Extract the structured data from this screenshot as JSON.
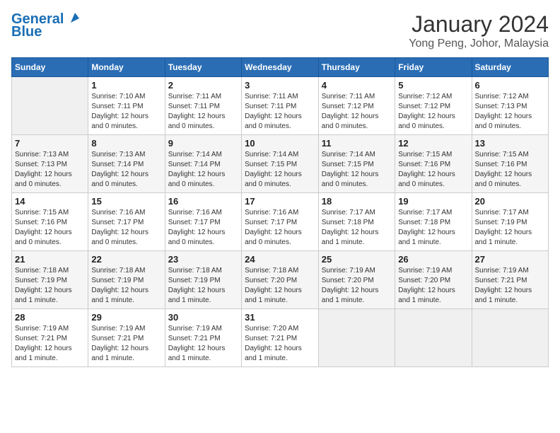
{
  "logo": {
    "line1": "General",
    "line2": "Blue"
  },
  "header": {
    "title": "January 2024",
    "subtitle": "Yong Peng, Johor, Malaysia"
  },
  "weekdays": [
    "Sunday",
    "Monday",
    "Tuesday",
    "Wednesday",
    "Thursday",
    "Friday",
    "Saturday"
  ],
  "weeks": [
    [
      {
        "day": "",
        "sunrise": "",
        "sunset": "",
        "daylight": ""
      },
      {
        "day": "1",
        "sunrise": "Sunrise: 7:10 AM",
        "sunset": "Sunset: 7:11 PM",
        "daylight": "Daylight: 12 hours and 0 minutes."
      },
      {
        "day": "2",
        "sunrise": "Sunrise: 7:11 AM",
        "sunset": "Sunset: 7:11 PM",
        "daylight": "Daylight: 12 hours and 0 minutes."
      },
      {
        "day": "3",
        "sunrise": "Sunrise: 7:11 AM",
        "sunset": "Sunset: 7:11 PM",
        "daylight": "Daylight: 12 hours and 0 minutes."
      },
      {
        "day": "4",
        "sunrise": "Sunrise: 7:11 AM",
        "sunset": "Sunset: 7:12 PM",
        "daylight": "Daylight: 12 hours and 0 minutes."
      },
      {
        "day": "5",
        "sunrise": "Sunrise: 7:12 AM",
        "sunset": "Sunset: 7:12 PM",
        "daylight": "Daylight: 12 hours and 0 minutes."
      },
      {
        "day": "6",
        "sunrise": "Sunrise: 7:12 AM",
        "sunset": "Sunset: 7:13 PM",
        "daylight": "Daylight: 12 hours and 0 minutes."
      }
    ],
    [
      {
        "day": "7",
        "sunrise": "Sunrise: 7:13 AM",
        "sunset": "Sunset: 7:13 PM",
        "daylight": "Daylight: 12 hours and 0 minutes."
      },
      {
        "day": "8",
        "sunrise": "Sunrise: 7:13 AM",
        "sunset": "Sunset: 7:14 PM",
        "daylight": "Daylight: 12 hours and 0 minutes."
      },
      {
        "day": "9",
        "sunrise": "Sunrise: 7:14 AM",
        "sunset": "Sunset: 7:14 PM",
        "daylight": "Daylight: 12 hours and 0 minutes."
      },
      {
        "day": "10",
        "sunrise": "Sunrise: 7:14 AM",
        "sunset": "Sunset: 7:15 PM",
        "daylight": "Daylight: 12 hours and 0 minutes."
      },
      {
        "day": "11",
        "sunrise": "Sunrise: 7:14 AM",
        "sunset": "Sunset: 7:15 PM",
        "daylight": "Daylight: 12 hours and 0 minutes."
      },
      {
        "day": "12",
        "sunrise": "Sunrise: 7:15 AM",
        "sunset": "Sunset: 7:16 PM",
        "daylight": "Daylight: 12 hours and 0 minutes."
      },
      {
        "day": "13",
        "sunrise": "Sunrise: 7:15 AM",
        "sunset": "Sunset: 7:16 PM",
        "daylight": "Daylight: 12 hours and 0 minutes."
      }
    ],
    [
      {
        "day": "14",
        "sunrise": "Sunrise: 7:15 AM",
        "sunset": "Sunset: 7:16 PM",
        "daylight": "Daylight: 12 hours and 0 minutes."
      },
      {
        "day": "15",
        "sunrise": "Sunrise: 7:16 AM",
        "sunset": "Sunset: 7:17 PM",
        "daylight": "Daylight: 12 hours and 0 minutes."
      },
      {
        "day": "16",
        "sunrise": "Sunrise: 7:16 AM",
        "sunset": "Sunset: 7:17 PM",
        "daylight": "Daylight: 12 hours and 0 minutes."
      },
      {
        "day": "17",
        "sunrise": "Sunrise: 7:16 AM",
        "sunset": "Sunset: 7:17 PM",
        "daylight": "Daylight: 12 hours and 0 minutes."
      },
      {
        "day": "18",
        "sunrise": "Sunrise: 7:17 AM",
        "sunset": "Sunset: 7:18 PM",
        "daylight": "Daylight: 12 hours and 1 minute."
      },
      {
        "day": "19",
        "sunrise": "Sunrise: 7:17 AM",
        "sunset": "Sunset: 7:18 PM",
        "daylight": "Daylight: 12 hours and 1 minute."
      },
      {
        "day": "20",
        "sunrise": "Sunrise: 7:17 AM",
        "sunset": "Sunset: 7:19 PM",
        "daylight": "Daylight: 12 hours and 1 minute."
      }
    ],
    [
      {
        "day": "21",
        "sunrise": "Sunrise: 7:18 AM",
        "sunset": "Sunset: 7:19 PM",
        "daylight": "Daylight: 12 hours and 1 minute."
      },
      {
        "day": "22",
        "sunrise": "Sunrise: 7:18 AM",
        "sunset": "Sunset: 7:19 PM",
        "daylight": "Daylight: 12 hours and 1 minute."
      },
      {
        "day": "23",
        "sunrise": "Sunrise: 7:18 AM",
        "sunset": "Sunset: 7:19 PM",
        "daylight": "Daylight: 12 hours and 1 minute."
      },
      {
        "day": "24",
        "sunrise": "Sunrise: 7:18 AM",
        "sunset": "Sunset: 7:20 PM",
        "daylight": "Daylight: 12 hours and 1 minute."
      },
      {
        "day": "25",
        "sunrise": "Sunrise: 7:19 AM",
        "sunset": "Sunset: 7:20 PM",
        "daylight": "Daylight: 12 hours and 1 minute."
      },
      {
        "day": "26",
        "sunrise": "Sunrise: 7:19 AM",
        "sunset": "Sunset: 7:20 PM",
        "daylight": "Daylight: 12 hours and 1 minute."
      },
      {
        "day": "27",
        "sunrise": "Sunrise: 7:19 AM",
        "sunset": "Sunset: 7:21 PM",
        "daylight": "Daylight: 12 hours and 1 minute."
      }
    ],
    [
      {
        "day": "28",
        "sunrise": "Sunrise: 7:19 AM",
        "sunset": "Sunset: 7:21 PM",
        "daylight": "Daylight: 12 hours and 1 minute."
      },
      {
        "day": "29",
        "sunrise": "Sunrise: 7:19 AM",
        "sunset": "Sunset: 7:21 PM",
        "daylight": "Daylight: 12 hours and 1 minute."
      },
      {
        "day": "30",
        "sunrise": "Sunrise: 7:19 AM",
        "sunset": "Sunset: 7:21 PM",
        "daylight": "Daylight: 12 hours and 1 minute."
      },
      {
        "day": "31",
        "sunrise": "Sunrise: 7:20 AM",
        "sunset": "Sunset: 7:21 PM",
        "daylight": "Daylight: 12 hours and 1 minute."
      },
      {
        "day": "",
        "sunrise": "",
        "sunset": "",
        "daylight": ""
      },
      {
        "day": "",
        "sunrise": "",
        "sunset": "",
        "daylight": ""
      },
      {
        "day": "",
        "sunrise": "",
        "sunset": "",
        "daylight": ""
      }
    ]
  ]
}
